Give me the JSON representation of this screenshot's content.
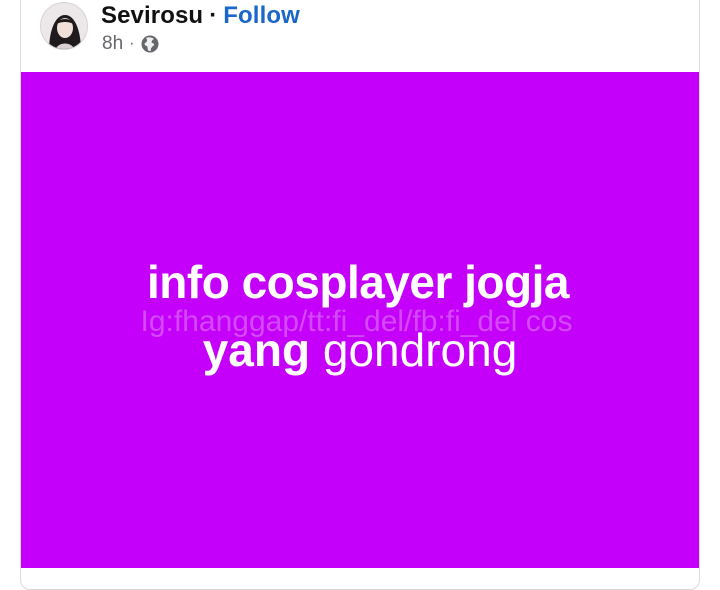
{
  "post": {
    "author": "Sevirosu",
    "separator": "·",
    "follow_label": "Follow",
    "time": "8h",
    "meta_separator": "·",
    "audience_icon": "globe-icon"
  },
  "image": {
    "background_color": "#c400fa",
    "line1": "info cosplayer jogja",
    "watermark": "Ig:fhanggap/tt:fi_del/fb:fi_del cos",
    "line2_bold": "yang",
    "line2_normal": "gondrong"
  },
  "colors": {
    "link": "#1b67c9",
    "meta": "#65676b"
  }
}
